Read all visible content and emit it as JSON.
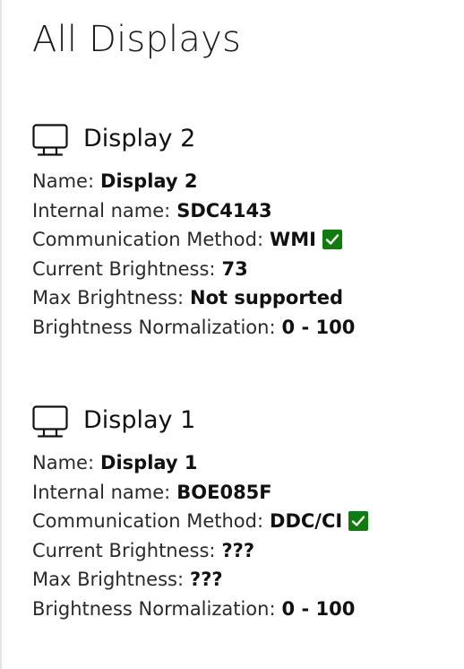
{
  "page": {
    "title": "All Displays"
  },
  "displays": [
    {
      "title": "Display 2",
      "icon": "monitor-icon",
      "properties": {
        "name": {
          "label": "Name:",
          "value": "Display 2"
        },
        "internal_name": {
          "label": "Internal name:",
          "value": "SDC4143"
        },
        "communication_method": {
          "label": "Communication Method:",
          "value": "WMI",
          "verified": true
        },
        "current_brightness": {
          "label": "Current Brightness:",
          "value": "73"
        },
        "max_brightness": {
          "label": "Max Brightness:",
          "value": "Not supported"
        },
        "brightness_normalization": {
          "label": "Brightness Normalization:",
          "value": "0 - 100"
        }
      }
    },
    {
      "title": "Display 1",
      "icon": "monitor-icon",
      "properties": {
        "name": {
          "label": "Name:",
          "value": "Display 1"
        },
        "internal_name": {
          "label": "Internal name:",
          "value": "BOE085F"
        },
        "communication_method": {
          "label": "Communication Method:",
          "value": "DDC/CI",
          "verified": true
        },
        "current_brightness": {
          "label": "Current Brightness:",
          "value": "???"
        },
        "max_brightness": {
          "label": "Max Brightness:",
          "value": "???"
        },
        "brightness_normalization": {
          "label": "Brightness Normalization:",
          "value": "0 - 100"
        }
      }
    }
  ],
  "colors": {
    "check_badge": "#107c10",
    "text": "#1a1a1a",
    "background": "#ffffff"
  }
}
